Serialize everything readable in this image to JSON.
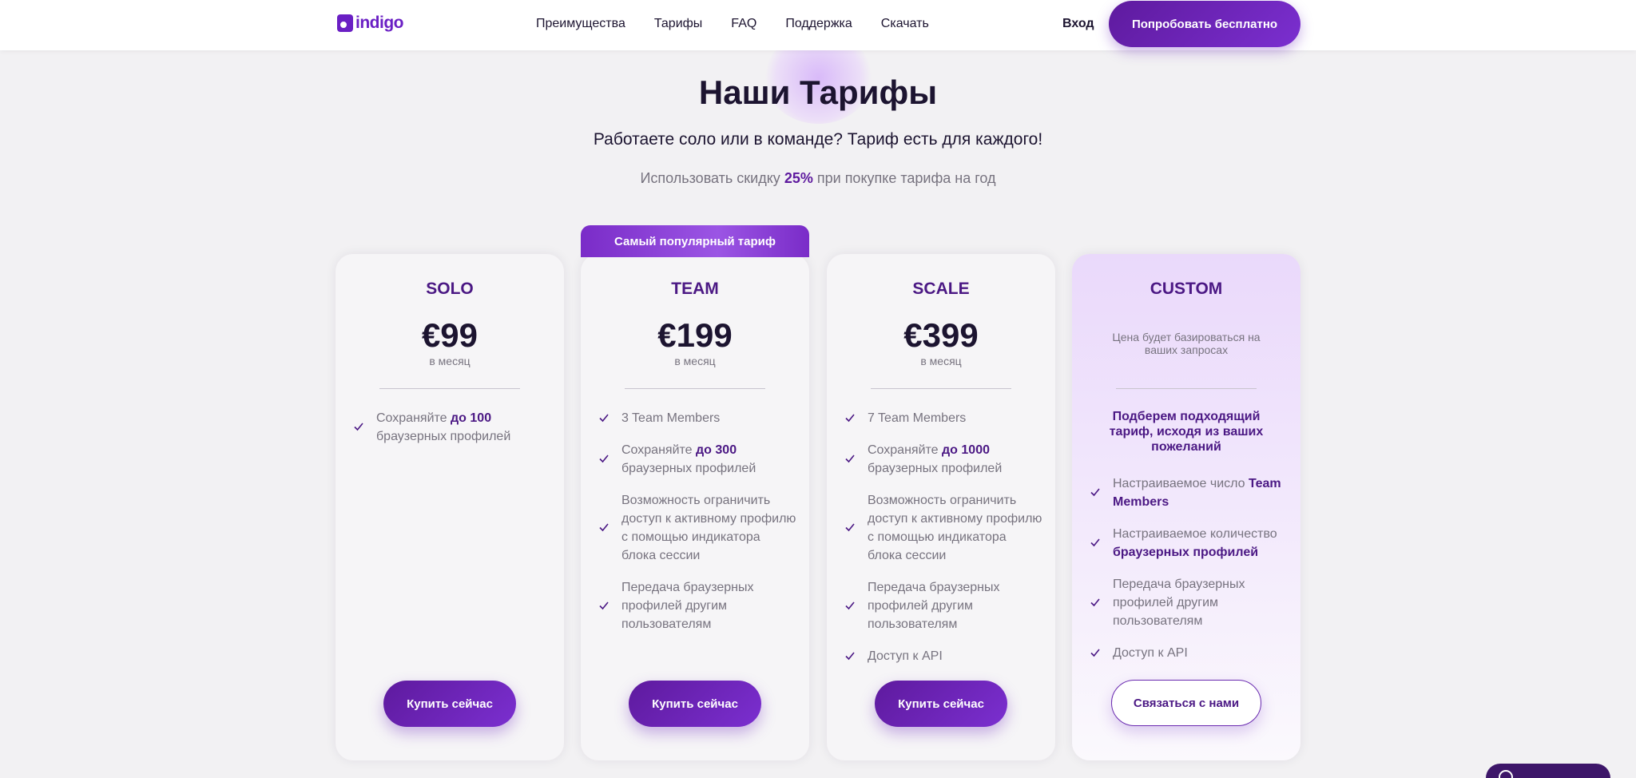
{
  "colors": {
    "brand": "#6a1fc4",
    "accent_dark": "#4b1884",
    "background": "#f2f1f3"
  },
  "nav": {
    "logo_text": "indigo",
    "links": [
      "Преимущества",
      "Тарифы",
      "FAQ",
      "Поддержка",
      "Скачать"
    ],
    "login": "Вход",
    "cta": "Попробовать бесплатно"
  },
  "hero": {
    "title": "Наши Тарифы",
    "subtitle": "Работаете соло или в команде? Тариф есть для каждого!",
    "discount_prefix": "Использовать скидку",
    "discount_value": "25%",
    "discount_suffix": "при покупке тарифа на год"
  },
  "popular_badge": "Самый популярный тариф",
  "plans": [
    {
      "name": "SOLO",
      "price": "€99",
      "period": "в месяц",
      "features": [
        {
          "pre": "Сохраняйте",
          "bold": "до 100",
          "post": "браузерных профилей"
        }
      ],
      "button": "Купить сейчас"
    },
    {
      "name": "TEAM",
      "price": "€199",
      "period": "в месяц",
      "features": [
        {
          "pre": "3 Team Members",
          "bold": "",
          "post": ""
        },
        {
          "pre": "Сохраняйте",
          "bold": "до 300",
          "post": "браузерных профилей"
        },
        {
          "pre": "Возможность ограничить доступ к активному профилю с помощью индикатора блока сессии",
          "bold": "",
          "post": ""
        },
        {
          "pre": "Передача браузерных профилей другим пользователям",
          "bold": "",
          "post": ""
        }
      ],
      "button": "Купить сейчас"
    },
    {
      "name": "SCALE",
      "price": "€399",
      "period": "в месяц",
      "features": [
        {
          "pre": "7 Team Members",
          "bold": "",
          "post": ""
        },
        {
          "pre": "Сохраняйте",
          "bold": "до 1000",
          "post": "браузерных профилей"
        },
        {
          "pre": "Возможность ограничить доступ к активному профилю с помощью индикатора блока сессии",
          "bold": "",
          "post": ""
        },
        {
          "pre": "Передача браузерных профилей другим пользователям",
          "bold": "",
          "post": ""
        },
        {
          "pre": "Доступ к API",
          "bold": "",
          "post": ""
        }
      ],
      "button": "Купить сейчас"
    },
    {
      "name": "CUSTOM",
      "price_note": "Цена будет базироваться на ваших запросах",
      "lead": "Подберем подходящий тариф, исходя из ваших пожеланий",
      "features": [
        {
          "pre": "Настраиваемое число",
          "bold": "Team Members",
          "post": ""
        },
        {
          "pre": "Настраиваемое количество",
          "bold": "браузерных профилей",
          "post": ""
        },
        {
          "pre": "Передача браузерных профилей другим пользователям",
          "bold": "",
          "post": ""
        },
        {
          "pre": "Доступ к API",
          "bold": "",
          "post": ""
        }
      ],
      "button": "Связаться с нами"
    }
  ]
}
